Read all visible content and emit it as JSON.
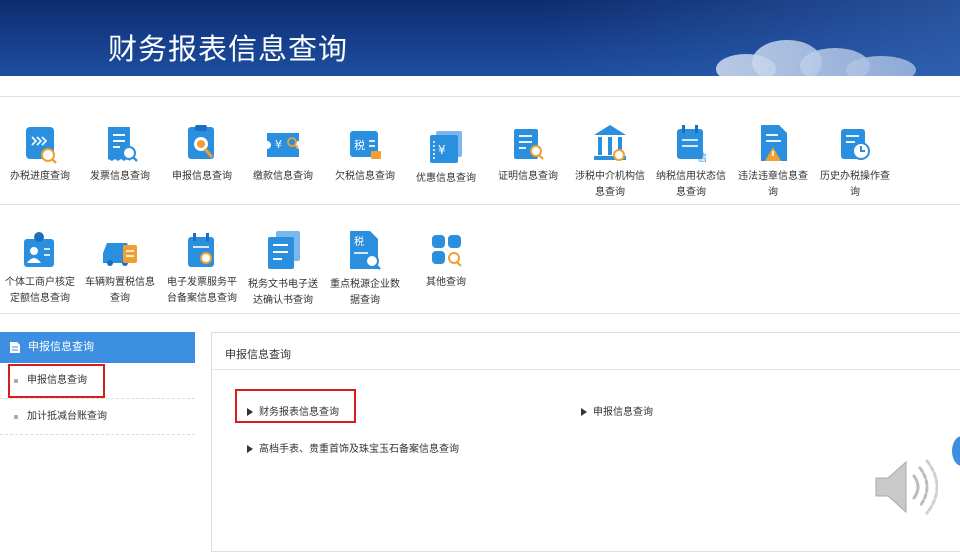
{
  "banner": {
    "title": "财务报表信息查询"
  },
  "icons_row1": [
    {
      "label": "办税进度查询",
      "icon": "progress-search-icon",
      "color": "#2b8fe0"
    },
    {
      "label": "发票信息查询",
      "icon": "invoice-search-icon",
      "color": "#2b8fe0"
    },
    {
      "label": "申报信息查询",
      "icon": "declaration-search-icon",
      "color": "#2b8fe0"
    },
    {
      "label": "缴款信息查询",
      "icon": "payment-ticket-icon",
      "color": "#2b8fe0"
    },
    {
      "label": "欠税信息查询",
      "icon": "tax-arrears-icon",
      "color": "#2b8fe0"
    },
    {
      "label": "优惠信息查询",
      "icon": "discount-ticket-icon",
      "color": "#2b8fe0"
    },
    {
      "label": "证明信息查询",
      "icon": "certificate-search-icon",
      "color": "#2b8fe0"
    },
    {
      "label": "涉税中介机构信息查询",
      "icon": "institution-building-icon",
      "color": "#2b8fe0"
    },
    {
      "label": "纳税信用状态信息查询",
      "icon": "credit-calendar-icon",
      "color": "#2b8fe0"
    },
    {
      "label": "违法违章信息查询",
      "icon": "warning-document-icon",
      "color": "#2b8fe0"
    },
    {
      "label": "历史办税操作查询",
      "icon": "history-clock-icon",
      "color": "#2b8fe0"
    }
  ],
  "icons_row2": [
    {
      "label": "个体工商户核定定额信息查询",
      "icon": "merchant-person-icon",
      "color": "#2b8fe0"
    },
    {
      "label": "车辆购置税信息查询",
      "icon": "vehicle-icon",
      "color": "#2b8fe0"
    },
    {
      "label": "电子发票服务平台备案信息查询",
      "icon": "calendar-search-icon",
      "color": "#2b8fe0"
    },
    {
      "label": "税务文书电子送达确认书查询",
      "icon": "documents-icon",
      "color": "#2b8fe0"
    },
    {
      "label": "重点税源企业数据查询",
      "icon": "tax-document-search-icon",
      "color": "#2b8fe0"
    },
    {
      "label": "其他查询",
      "icon": "grid-search-icon",
      "color": "#2b8fe0"
    }
  ],
  "sidebar": {
    "header": "申报信息查询",
    "items": [
      {
        "label": "申报信息查询"
      },
      {
        "label": "加计抵减台账查询"
      }
    ]
  },
  "panel": {
    "title": "申报信息查询",
    "links": [
      {
        "label": "财务报表信息查询"
      },
      {
        "label": "申报信息查询"
      },
      {
        "label": "高档手表、贵重首饰及珠宝玉石备案信息查询"
      }
    ]
  },
  "colors": {
    "accent": "#3d8fe2",
    "highlight": "#d61e1e",
    "banner": "#163f8c"
  }
}
